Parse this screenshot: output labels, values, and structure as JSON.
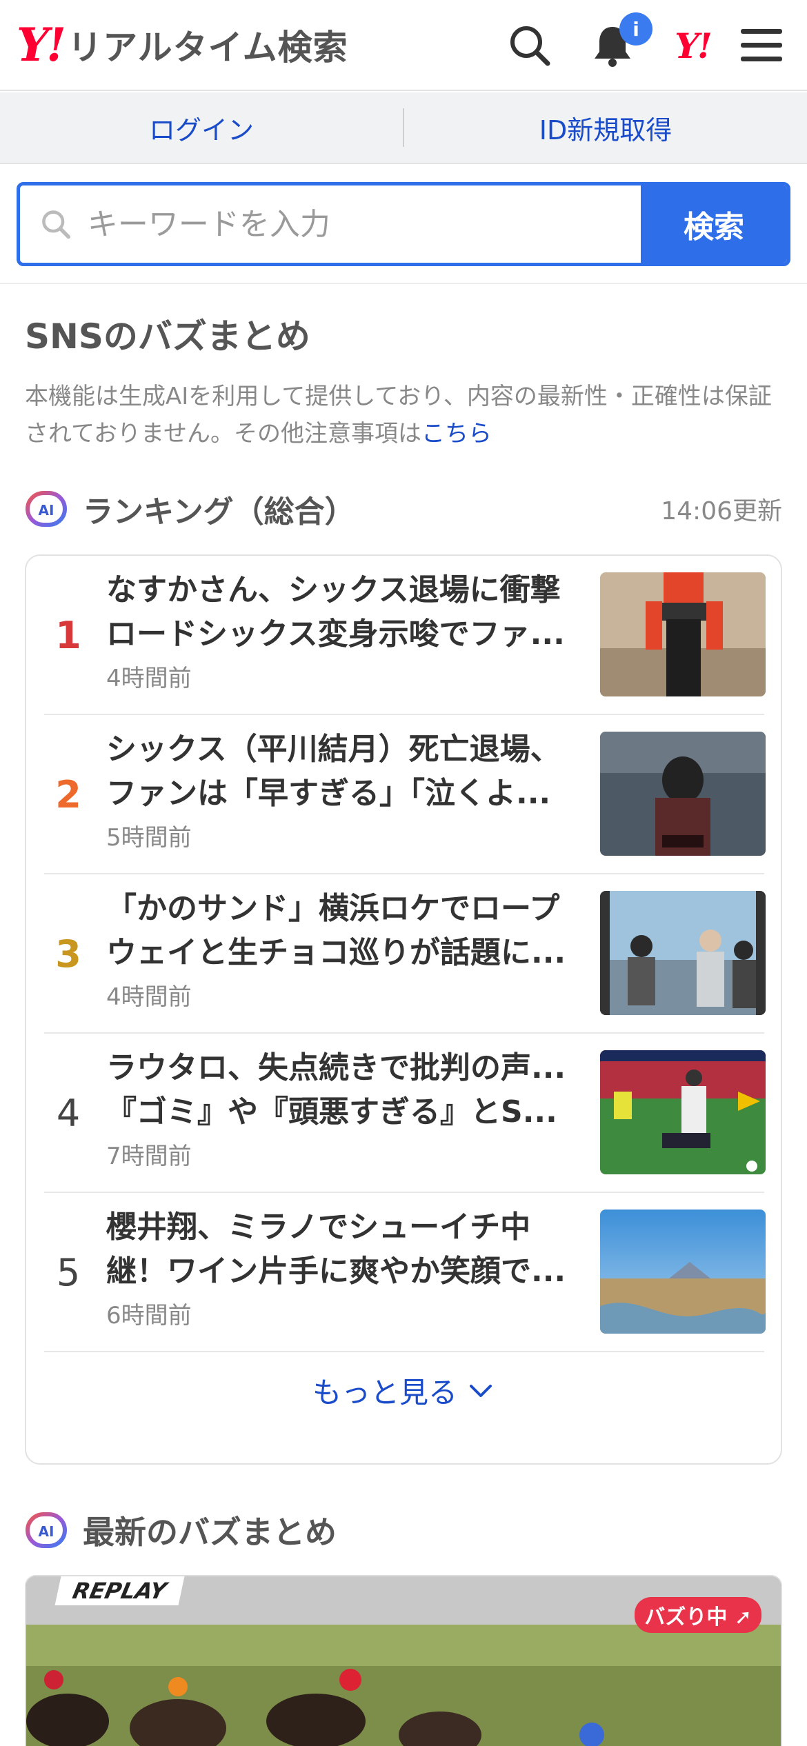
{
  "header": {
    "logo_mark": "Y!",
    "logo_text": "リアルタイム検索",
    "notification_badge": "i",
    "yj_mark": "Y!"
  },
  "login_bar": {
    "login": "ログイン",
    "register": "ID新規取得"
  },
  "search": {
    "placeholder": "キーワードを入力",
    "button": "検索"
  },
  "sns_section": {
    "title": "SNSのバズまとめ",
    "notice": "本機能は生成AIを利用して提供しており、内容の最新性・正確性は保証されておりません。その他注意事項は",
    "notice_link": "こちら"
  },
  "ranking": {
    "ai_label": "AI",
    "title": "ランキング（総合）",
    "updated": "14:06更新",
    "items": [
      {
        "rank": "1",
        "title": "なすかさん、シックス退場に衝撃ロードシックス変身示唆でファ...",
        "time": "4時間前",
        "rank_color": "#d8383a"
      },
      {
        "rank": "2",
        "title": "シックス（平川結月）死亡退場、ファンは「早すぎる」「泣くよ...",
        "time": "5時間前",
        "rank_color": "#ee6a2c"
      },
      {
        "rank": "3",
        "title": "「かのサンド」横浜ロケでロープウェイと生チョコ巡りが話題に...",
        "time": "4時間前",
        "rank_color": "#c9961f"
      },
      {
        "rank": "4",
        "title": "ラウタロ、失点続きで批判の声...『ゴミ』や『頭悪すぎる』とS...",
        "time": "7時間前",
        "rank_color": "#444444"
      },
      {
        "rank": "5",
        "title": "櫻井翔、ミラノでシューイチ中継！ワイン片手に爽やか笑顔で...",
        "time": "6時間前",
        "rank_color": "#444444"
      }
    ],
    "more": "もっと見る"
  },
  "latest": {
    "ai_label": "AI",
    "title": "最新のバズまとめ",
    "badge": "バズり中",
    "replay": "REPLAY"
  }
}
